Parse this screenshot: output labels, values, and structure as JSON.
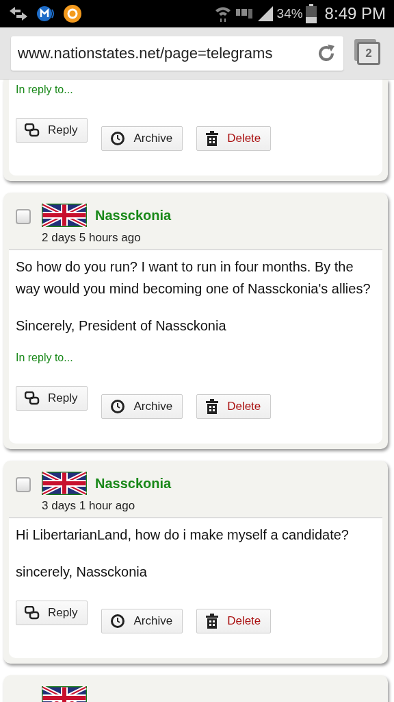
{
  "status_bar": {
    "battery": "34%",
    "time": "8:49 PM"
  },
  "browser": {
    "url": "www.nationstates.net/page=telegrams",
    "tab_count": "2"
  },
  "messages": [
    {
      "kind": "continued",
      "in_reply": "In reply to...",
      "buttons": [
        {
          "kind": "reply",
          "label": "Reply"
        },
        {
          "kind": "archive",
          "label": "Archive"
        },
        {
          "kind": "delete",
          "label": "Delete"
        }
      ]
    },
    {
      "kind": "message",
      "checked": false,
      "sender": "Nassckonia",
      "time": "2 days 5 hours ago",
      "paragraphs": [
        "So how do you run? I want to run in four months. By the way would you mind becoming one of Nassckonia's allies?",
        "Sincerely, President of Nassckonia"
      ],
      "in_reply": "In reply to...",
      "buttons": [
        {
          "kind": "reply",
          "label": "Reply"
        },
        {
          "kind": "archive",
          "label": "Archive"
        },
        {
          "kind": "delete",
          "label": "Delete"
        }
      ]
    },
    {
      "kind": "message",
      "checked": false,
      "sender": "Nassckonia",
      "time": "3 days 1 hour ago",
      "paragraphs": [
        "Hi LibertarianLand, how do i make myself a candidate?",
        "sincerely, Nassckonia"
      ],
      "buttons": [
        {
          "kind": "reply",
          "label": "Reply"
        },
        {
          "kind": "archive",
          "label": "Archive"
        },
        {
          "kind": "delete",
          "label": "Delete"
        }
      ]
    },
    {
      "kind": "preview"
    }
  ]
}
